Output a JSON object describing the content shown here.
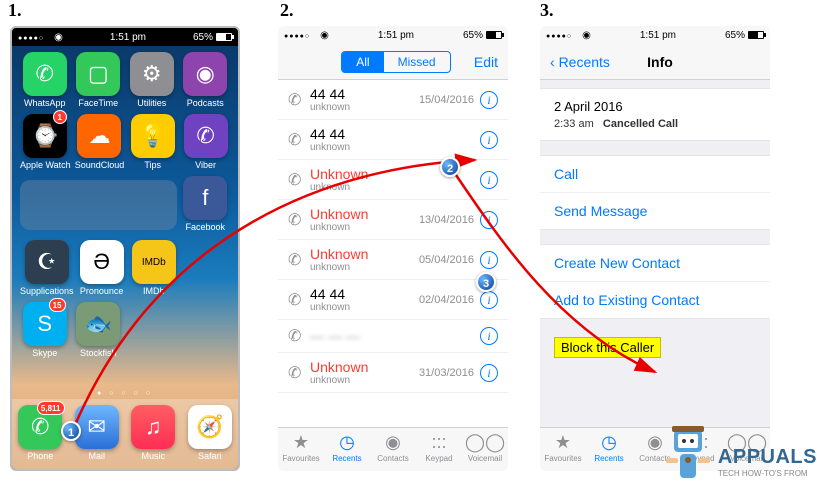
{
  "steps": {
    "s1": "1.",
    "s2": "2.",
    "s3": "3."
  },
  "annotations": {
    "a1": "1",
    "a2": "2",
    "a3": "3"
  },
  "status": {
    "time": "1:51 pm",
    "battery_pct": "65%"
  },
  "home": {
    "apps_row1": [
      {
        "label": "WhatsApp",
        "bg": "#25d366",
        "glyph": "✆"
      },
      {
        "label": "FaceTime",
        "bg": "#34c759",
        "glyph": "▢"
      },
      {
        "label": "Utilities",
        "bg": "#8e8e93",
        "glyph": "⚙"
      },
      {
        "label": "Podcasts",
        "bg": "#8e44ad",
        "glyph": "◉"
      }
    ],
    "apps_row2": [
      {
        "label": "Apple Watch",
        "bg": "#000",
        "glyph": "⌚",
        "badge": "1"
      },
      {
        "label": "SoundCloud",
        "bg": "#ff6600",
        "glyph": "☁"
      },
      {
        "label": "Tips",
        "bg": "#ffcc00",
        "glyph": "💡"
      },
      {
        "label": "Viber",
        "bg": "#6f42c1",
        "glyph": "✆"
      }
    ],
    "apps_row3_right": {
      "label": "Facebook",
      "bg": "#3b5998",
      "glyph": "f"
    },
    "apps_row4": [
      {
        "label": "Supplications",
        "bg": "#2c3e50",
        "glyph": "☪"
      },
      {
        "label": "Pronounce",
        "bg": "#fff",
        "glyph": "Ə",
        "fg": "#000"
      },
      {
        "label": "IMDb",
        "bg": "#f5c518",
        "glyph": "IMDb",
        "fg": "#000",
        "fs": "10px"
      }
    ],
    "apps_row5": [
      {
        "label": "Skype",
        "bg": "#00aff0",
        "glyph": "S",
        "badge": "15"
      },
      {
        "label": "Stockfish",
        "bg": "#7a9b76",
        "glyph": "🐟"
      }
    ],
    "dock": [
      {
        "label": "Phone",
        "bg": "#34c759",
        "glyph": "✆",
        "badge": "5,811"
      },
      {
        "label": "Mail",
        "bg": "linear-gradient(#6fb7ff,#2a6fd6)",
        "glyph": "✉"
      },
      {
        "label": "Music",
        "bg": "linear-gradient(#ff5e62,#ff2d55)",
        "glyph": "♫"
      },
      {
        "label": "Safari",
        "bg": "#fff",
        "glyph": "🧭"
      }
    ]
  },
  "recents": {
    "seg_all": "All",
    "seg_missed": "Missed",
    "edit": "Edit",
    "rows": [
      {
        "name": "44 44",
        "sub": "unknown",
        "date": "15/04/2016",
        "red": false
      },
      {
        "name": "44 44",
        "sub": "unknown",
        "date": "",
        "red": false
      },
      {
        "name": "Unknown",
        "sub": "unknown",
        "date": "",
        "red": true
      },
      {
        "name": "Unknown",
        "sub": "unknown",
        "date": "13/04/2016",
        "red": true
      },
      {
        "name": "Unknown",
        "sub": "unknown",
        "date": "05/04/2016",
        "red": true
      },
      {
        "name": "44 44",
        "sub": "unknown",
        "date": "02/04/2016",
        "red": false
      },
      {
        "name": "",
        "sub": "",
        "date": "",
        "red": false,
        "blur": true
      },
      {
        "name": "Unknown",
        "sub": "unknown",
        "date": "31/03/2016",
        "red": true
      }
    ],
    "tabs": [
      "Favourites",
      "Recents",
      "Contacts",
      "Keypad",
      "Voicemail"
    ],
    "tab_icons": [
      "★",
      "◷",
      "◉",
      ":::",
      "◯◯"
    ]
  },
  "info": {
    "back": "Recents",
    "title": "Info",
    "date": "2 April 2016",
    "time": "2:33 am",
    "status": "Cancelled Call",
    "actions1": [
      "Call",
      "Send Message"
    ],
    "actions2": [
      "Create New Contact",
      "Add to Existing Contact"
    ],
    "block": "Block this Caller"
  },
  "branding": {
    "name": "APPUALS",
    "tag": "TECH HOW-TO'S FROM"
  }
}
